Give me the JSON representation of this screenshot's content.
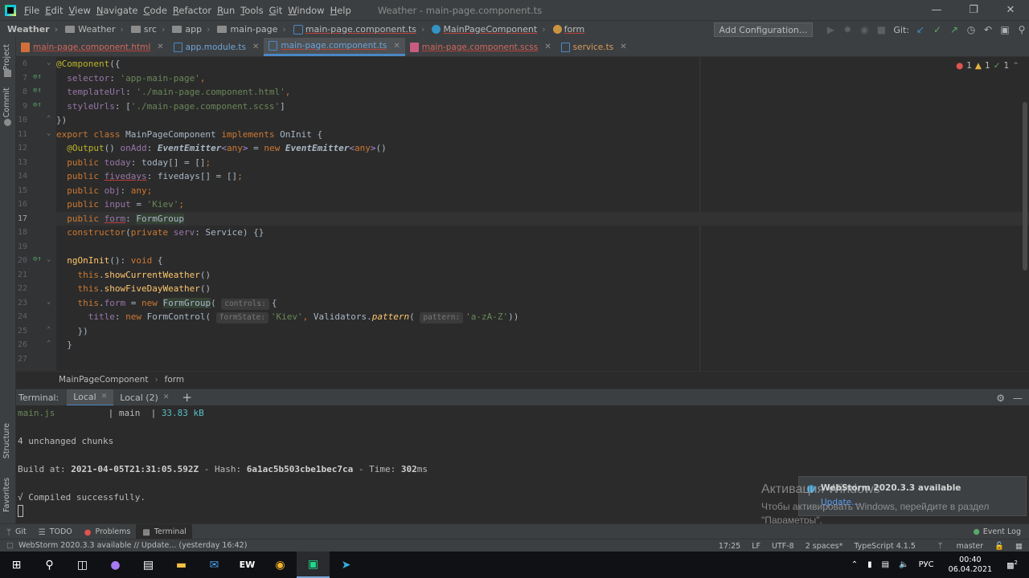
{
  "window": {
    "title": "Weather - main-page.component.ts",
    "menu": [
      "File",
      "Edit",
      "View",
      "Navigate",
      "Code",
      "Refactor",
      "Run",
      "Tools",
      "Git",
      "Window",
      "Help"
    ]
  },
  "navbar": {
    "breadcrumb": [
      "Weather",
      "Weather",
      "src",
      "app",
      "main-page",
      "main-page.component.ts",
      "MainPageComponent",
      "form"
    ],
    "add_config": "Add Configuration...",
    "git_label": "Git:"
  },
  "left_stripe": [
    "Project",
    "Commit",
    "Structure",
    "Favorites"
  ],
  "tabs": [
    {
      "label": "main-page.component.html"
    },
    {
      "label": "app.module.ts"
    },
    {
      "label": "main-page.component.ts"
    },
    {
      "label": "main-page.component.scss"
    },
    {
      "label": "service.ts"
    }
  ],
  "inspection": {
    "errors": "1",
    "warnings": "1",
    "ok": "1"
  },
  "editor": {
    "line_numbers": [
      "6",
      "7",
      "8",
      "9",
      "10",
      "11",
      "12",
      "13",
      "14",
      "15",
      "16",
      "17",
      "18",
      "19",
      "20",
      "21",
      "22",
      "23",
      "24",
      "25",
      "26",
      "27"
    ],
    "hints": {
      "controls": "controls:",
      "formState": "formState:",
      "pattern": "pattern:"
    },
    "code_breadcrumb": [
      "MainPageComponent",
      "form"
    ]
  },
  "terminal": {
    "title": "Terminal:",
    "tabs": [
      "Local",
      "Local (2)"
    ],
    "lines": {
      "l1_file": "main.js",
      "l1_sep": "          | main  | ",
      "l1_size": "33.83 kB",
      "l2": "4 unchanged chunks",
      "l3_prefix": "Build at: ",
      "l3_date": "2021-04-05T21:31:05.592Z",
      "l3_mid": " - Hash: ",
      "l3_hash": "6a1ac5b503cbe1bec7ca",
      "l3_time_pre": " - Time: ",
      "l3_time": "302",
      "l3_ms": "ms",
      "l4": "√ Compiled successfully."
    }
  },
  "notification": {
    "title": "WebStorm 2020.3.3 available",
    "link": "Update..."
  },
  "watermark": {
    "title": "Активация Windows",
    "text": "Чтобы активировать Windows, перейдите в раздел \"Параметры\"."
  },
  "bottom_tools": [
    "Git",
    "TODO",
    "Problems",
    "Terminal"
  ],
  "event_log": "Event Log",
  "status": {
    "message": "WebStorm 2020.3.3 available // Update... (yesterday 16:42)",
    "position": "17:25",
    "line_sep": "LF",
    "encoding": "UTF-8",
    "indent": "2 spaces*",
    "lang": "TypeScript 4.1.5",
    "branch": "master"
  },
  "taskbar": {
    "lang": "РУС",
    "time": "00:40",
    "date": "06.04.2021",
    "notif_count": "2"
  }
}
